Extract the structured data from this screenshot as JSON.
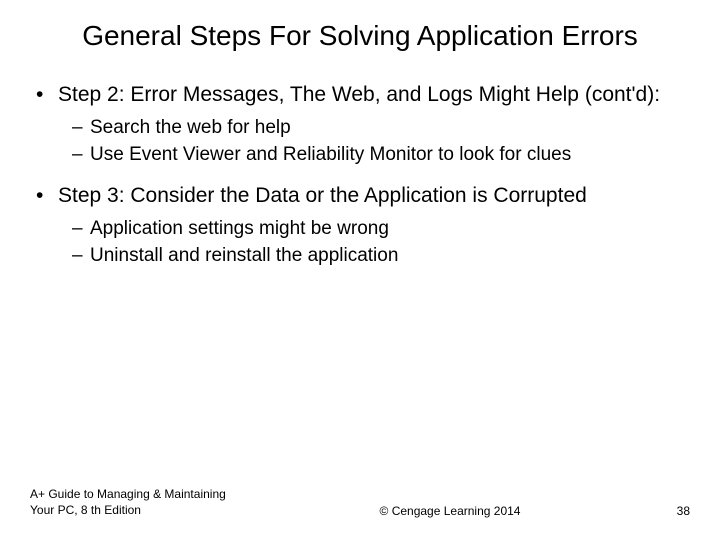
{
  "title": "General Steps For Solving Application Errors",
  "items": [
    {
      "text": "Step 2: Error Messages, The Web, and Logs Might Help (cont'd):",
      "sub": [
        "Search the web for help",
        "Use Event Viewer and Reliability Monitor to look for clues"
      ]
    },
    {
      "text": "Step 3: Consider the Data or the Application is Corrupted",
      "sub": [
        "Application settings might be wrong",
        "Uninstall and reinstall the application"
      ]
    }
  ],
  "footer": {
    "left": "A+ Guide to Managing & Maintaining Your PC, 8 th Edition",
    "center": "© Cengage Learning  2014",
    "right": "38"
  }
}
